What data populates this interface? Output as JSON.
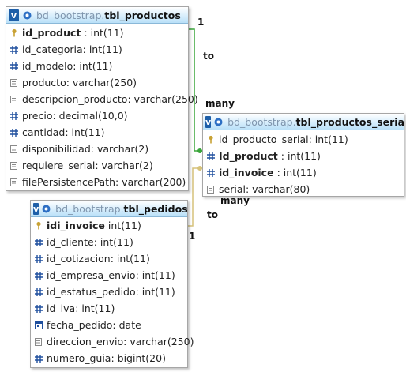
{
  "tables": {
    "productos": {
      "db": "bd_bootstrap.",
      "name": "tbl_productos",
      "columns": [
        {
          "key": true,
          "name": "id_product",
          "type": " : int(11)",
          "icon": "key-icon"
        },
        {
          "name": "id_categoria",
          "type": " : int(11)",
          "icon": "hash-icon"
        },
        {
          "name": "id_modelo",
          "type": " : int(11)",
          "icon": "hash-icon"
        },
        {
          "name": "producto",
          "type": " : varchar(250)",
          "icon": "text-icon"
        },
        {
          "name": "descripcion_producto",
          "type": " : varchar(250)",
          "icon": "text-icon"
        },
        {
          "name": "precio",
          "type": " : decimal(10,0)",
          "icon": "hash-icon"
        },
        {
          "name": "cantidad",
          "type": " : int(11)",
          "icon": "hash-icon"
        },
        {
          "name": "disponibilidad",
          "type": " : varchar(2)",
          "icon": "text-icon"
        },
        {
          "name": "requiere_serial",
          "type": " : varchar(2)",
          "icon": "text-icon"
        },
        {
          "name": "filePersistencePath",
          "type": " : varchar(200)",
          "icon": "text-icon"
        }
      ]
    },
    "seriales": {
      "db": "bd_bootstrap.",
      "name": "tbl_productos_seriales",
      "columns": [
        {
          "name": "id_producto_serial",
          "type": " : int(11)",
          "icon": "key-icon"
        },
        {
          "key": true,
          "name": "Id_product",
          "type": " : int(11)",
          "icon": "hash-icon"
        },
        {
          "key": true,
          "name": "id_invoice",
          "type": " : int(11)",
          "icon": "hash-icon"
        },
        {
          "name": "serial",
          "type": " : varchar(80)",
          "icon": "text-icon"
        }
      ]
    },
    "pedidos": {
      "db": "bd_bootstrap.",
      "name": "tbl_pedidos",
      "columns": [
        {
          "key": true,
          "name": "idi_invoice",
          "type": " int(11)",
          "icon": "key-icon"
        },
        {
          "name": "id_cliente",
          "type": " : int(11)",
          "icon": "hash-icon"
        },
        {
          "name": "id_cotizacion",
          "type": " : int(11)",
          "icon": "hash-icon"
        },
        {
          "name": "id_empresa_envio",
          "type": " : int(11)",
          "icon": "hash-icon"
        },
        {
          "name": "id_estatus_pedido",
          "type": " : int(11)",
          "icon": "hash-icon"
        },
        {
          "name": "id_iva",
          "type": " : int(11)",
          "icon": "hash-icon"
        },
        {
          "name": "fecha_pedido",
          "type": " : date",
          "icon": "date-icon"
        },
        {
          "name": "direccion_envio",
          "type": " : varchar(250)",
          "icon": "text-icon"
        },
        {
          "name": "numero_guia",
          "type": " : bigint(20)",
          "icon": "hash-icon"
        }
      ]
    }
  },
  "relations": {
    "r1": {
      "from_card": "1",
      "mid": "to",
      "to_card": "many",
      "color": "#3aa53a"
    },
    "r2": {
      "from_card": "many",
      "mid": "to",
      "to_card": "1",
      "color": "#d6c27a"
    }
  },
  "header_button": "v",
  "colors": {
    "key": "#c8a235",
    "hash": "#1f4f9e",
    "text": "#8a8a8a",
    "relation1": "#3aa53a",
    "relation2": "#d6c27a"
  }
}
